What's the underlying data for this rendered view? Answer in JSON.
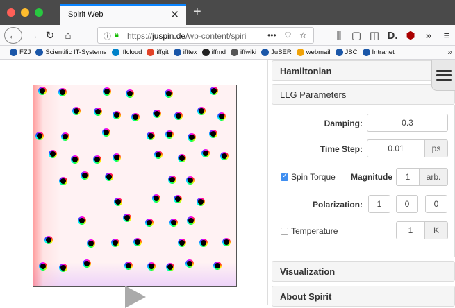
{
  "browser": {
    "tab_title": "Spirit Web",
    "tab_close": "✕",
    "new_tab": "+",
    "url_prefix": "https://",
    "url_domain": "juspin.de",
    "url_path": "/wp-content/spiri",
    "url_more": "•••",
    "icons": [
      "back-icon",
      "forward-icon",
      "reload-icon",
      "home-icon",
      "info-icon",
      "lock-icon",
      "pocket-icon",
      "bookmark-star-icon",
      "library-icon",
      "reader-icon",
      "sidebar-icon",
      "extension-icon",
      "ublock-icon",
      "overflow-icon",
      "hamburger-icon"
    ]
  },
  "bookmarks": [
    {
      "label": "FZJ",
      "color": "#1a56a8"
    },
    {
      "label": "Scientific IT-Systems",
      "color": "#1a56a8"
    },
    {
      "label": "iffcloud",
      "color": "#0082c9"
    },
    {
      "label": "iffgit",
      "color": "#e24329"
    },
    {
      "label": "ifftex",
      "color": "#1a56a8"
    },
    {
      "label": "iffmd",
      "color": "#222222"
    },
    {
      "label": "iffwiki",
      "color": "#555555"
    },
    {
      "label": "JuSER",
      "color": "#1a56a8"
    },
    {
      "label": "webmail",
      "color": "#f0a30a"
    },
    {
      "label": "JSC",
      "color": "#1a56a8"
    },
    {
      "label": "Intranet",
      "color": "#1a56a8"
    }
  ],
  "panel": {
    "hamiltonian": "Hamiltonian",
    "llg": "LLG Parameters",
    "visualization": "Visualization",
    "about": "About Spirit",
    "damping_label": "Damping:",
    "damping_value": "0.3",
    "timestep_label": "Time Step:",
    "timestep_value": "0.01",
    "timestep_unit": "ps",
    "spin_torque_label": "Spin Torque",
    "spin_torque_checked": true,
    "magnitude_label": "Magnitude",
    "magnitude_value": "1",
    "magnitude_unit": "arb.",
    "polarization_label": "Polarization:",
    "polarization": [
      "1",
      "0",
      "0"
    ],
    "temperature_label": "Temperature",
    "temperature_checked": false,
    "temperature_value": "1",
    "temperature_unit": "K"
  },
  "colors": {
    "accent": "#3f8ef0",
    "tab_highlight": "#0a84ff",
    "tabbar": "#4a4a4a"
  }
}
